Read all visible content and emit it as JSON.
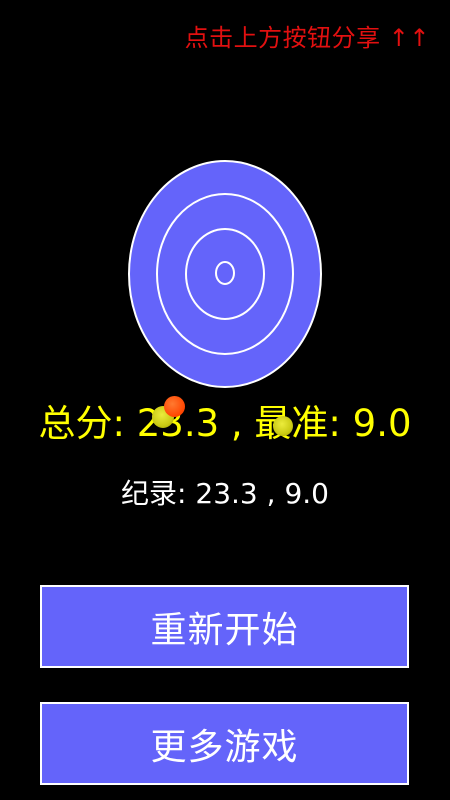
{
  "header": {
    "share_hint": "点击上方按钮分享 ↑↑"
  },
  "target": {
    "fill_color": "#6464fa",
    "ring_color": "#ffffff"
  },
  "score": {
    "total_label": "总分:",
    "total_value": "23.3",
    "separator": ",",
    "best_label": "最准:",
    "best_value": "9.0",
    "text_color": "#ffff00"
  },
  "record": {
    "label": "纪录:",
    "total_value": "23.3",
    "separator": ",",
    "best_value": "9.0"
  },
  "buttons": {
    "restart_label": "重新开始",
    "more_games_label": "更多游戏",
    "fill_color": "#6464fa"
  },
  "darts": {
    "colors": [
      "#caca14",
      "#ff4500",
      "#caca14"
    ]
  }
}
